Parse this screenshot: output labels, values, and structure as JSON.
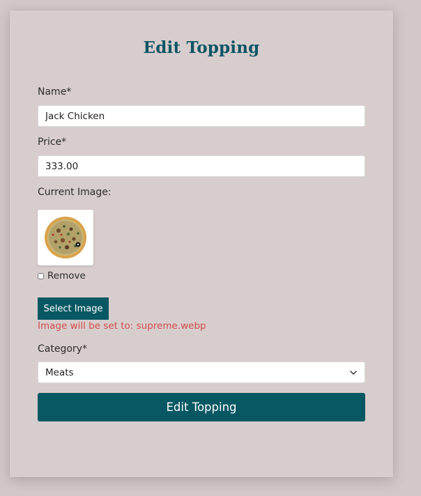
{
  "form": {
    "title": "Edit Topping",
    "name_label": "Name*",
    "name_value": "Jack Chicken",
    "price_label": "Price*",
    "price_value": "333.00",
    "current_image_label": "Current Image:",
    "remove_label": "Remove",
    "remove_checked": false,
    "select_image_label": "Select Image",
    "image_notice": "Image will be set to: supreme.webp",
    "category_label": "Category*",
    "category_value": "Meats",
    "submit_label": "Edit Topping"
  },
  "icons": {
    "chevron": "chevron-down-icon",
    "image": "pizza-thumbnail"
  },
  "colors": {
    "page_bg": "#d3c8c8",
    "card_bg": "#d8cdcd",
    "title": "#0b5566",
    "primary_button": "#075863",
    "notice_text": "#d24b4b"
  }
}
